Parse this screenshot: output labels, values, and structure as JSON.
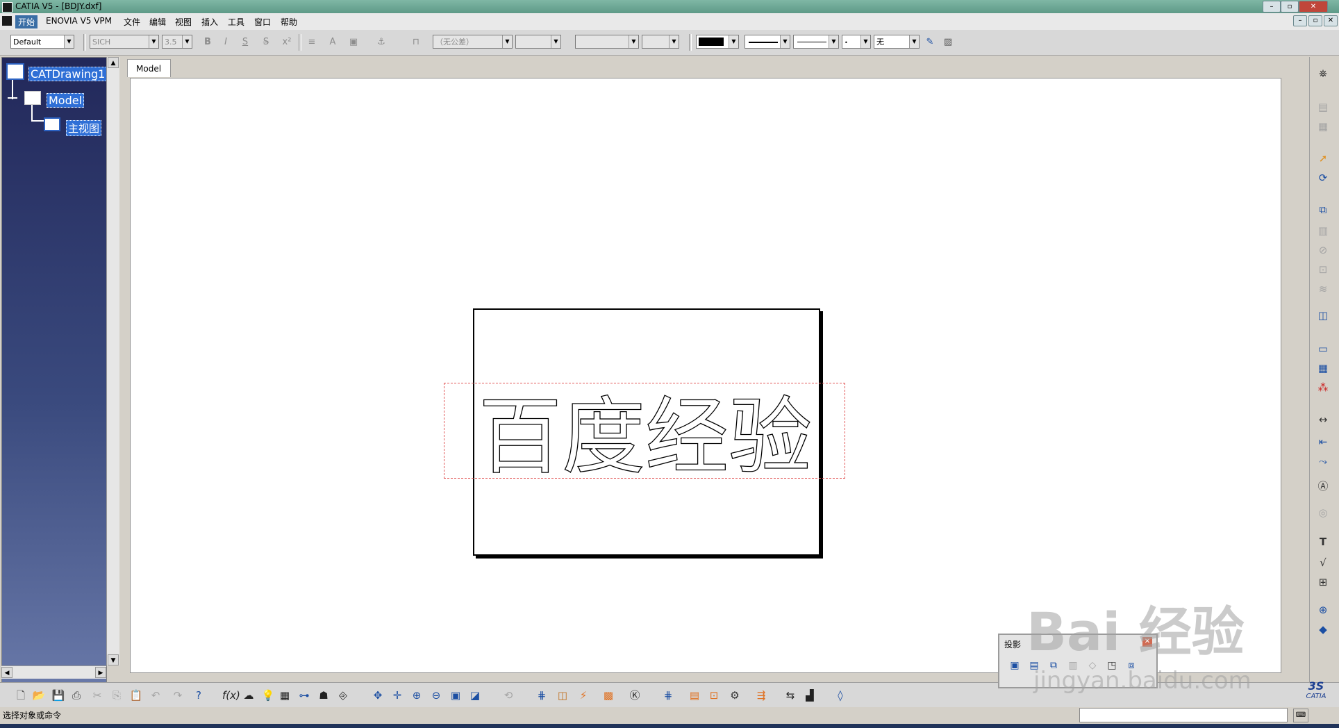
{
  "window": {
    "title": "CATIA V5 - [BDJY.dxf]"
  },
  "menu": {
    "items": [
      "开始",
      "ENOVIA V5 VPM",
      "文件",
      "编辑",
      "视图",
      "插入",
      "工具",
      "窗口",
      "帮助"
    ]
  },
  "toolbar": {
    "style_value": "Default",
    "font_value": "SICH",
    "size_value": "3.5",
    "tolerance_value": "（无公差）",
    "fill_none_label": "无"
  },
  "tree": {
    "root": "CATDrawing1",
    "child": "Model",
    "grandchild": "主视图"
  },
  "sheet_tab": "Model",
  "drawing": {
    "text": "百度经验"
  },
  "projection_panel": {
    "title": "投影"
  },
  "status": {
    "prompt": "选择对象或命令"
  },
  "watermark": {
    "logo": "Bai 经验",
    "url": "jingyan.baidu.com"
  },
  "brand": {
    "logo": "CATIA"
  },
  "colors": {
    "tree_selection": "#2f6fd6",
    "selection_box": "#e25a5a",
    "title_bar": "#6ea795"
  }
}
